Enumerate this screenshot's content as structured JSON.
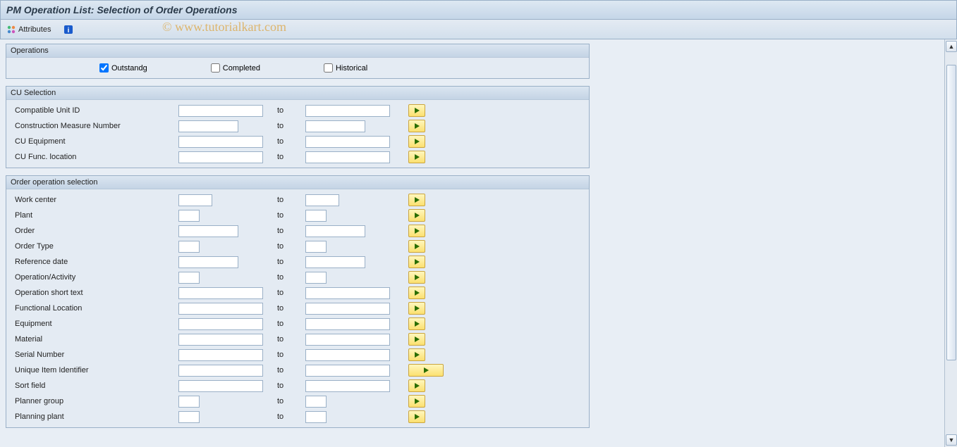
{
  "header": {
    "title": "PM Operation List: Selection of Order Operations"
  },
  "toolbar": {
    "attributes_label": "Attributes"
  },
  "watermark": "© www.tutorialkart.com",
  "groups": {
    "operations": {
      "title": "Operations",
      "checks": {
        "outstanding": {
          "label": "Outstandg",
          "checked": true
        },
        "completed": {
          "label": "Completed",
          "checked": false
        },
        "historical": {
          "label": "Historical",
          "checked": false
        }
      }
    },
    "cu_selection": {
      "title": "CU Selection",
      "rows": [
        {
          "label": "Compatible Unit ID",
          "to": "to",
          "from_w": "w-lg",
          "to_w": "w-lg"
        },
        {
          "label": "Construction Measure Number",
          "to": "to",
          "from_w": "w-md",
          "to_w": "w-md"
        },
        {
          "label": "CU Equipment",
          "to": "to",
          "from_w": "w-lg",
          "to_w": "w-lg"
        },
        {
          "label": "CU Func. location",
          "to": "to",
          "from_w": "w-lg",
          "to_w": "w-lg"
        }
      ]
    },
    "order_op_selection": {
      "title": "Order operation selection",
      "rows": [
        {
          "label": "Work center",
          "to": "to",
          "from_w": "w-sm",
          "to_w": "w-sm",
          "btn": "normal"
        },
        {
          "label": "Plant",
          "to": "to",
          "from_w": "w-xs",
          "to_w": "w-xs",
          "btn": "normal"
        },
        {
          "label": "Order",
          "to": "to",
          "from_w": "w-md",
          "to_w": "w-md",
          "btn": "normal"
        },
        {
          "label": "Order Type",
          "to": "to",
          "from_w": "w-xs",
          "to_w": "w-xs",
          "btn": "normal"
        },
        {
          "label": "Reference date",
          "to": "to",
          "from_w": "w-md",
          "to_w": "w-md",
          "btn": "normal"
        },
        {
          "label": "Operation/Activity",
          "to": "to",
          "from_w": "w-xs",
          "to_w": "w-xs",
          "btn": "normal"
        },
        {
          "label": "Operation short text",
          "to": "to",
          "from_w": "w-lg",
          "to_w": "w-lg",
          "btn": "normal"
        },
        {
          "label": "Functional Location",
          "to": "to",
          "from_w": "w-lg",
          "to_w": "w-lg",
          "btn": "normal"
        },
        {
          "label": "Equipment",
          "to": "to",
          "from_w": "w-lg",
          "to_w": "w-lg",
          "btn": "normal"
        },
        {
          "label": "Material",
          "to": "to",
          "from_w": "w-lg",
          "to_w": "w-lg",
          "btn": "normal"
        },
        {
          "label": "Serial Number",
          "to": "to",
          "from_w": "w-lg",
          "to_w": "w-lg",
          "btn": "normal"
        },
        {
          "label": "Unique Item Identifier",
          "to": "to",
          "from_w": "w-lg",
          "to_w": "w-lg",
          "btn": "wide"
        },
        {
          "label": "Sort field",
          "to": "to",
          "from_w": "w-lg",
          "to_w": "w-lg",
          "btn": "normal"
        },
        {
          "label": "Planner group",
          "to": "to",
          "from_w": "w-xs",
          "to_w": "w-xs",
          "btn": "normal"
        },
        {
          "label": "Planning plant",
          "to": "to",
          "from_w": "w-xs",
          "to_w": "w-xs",
          "btn": "normal"
        }
      ]
    }
  }
}
